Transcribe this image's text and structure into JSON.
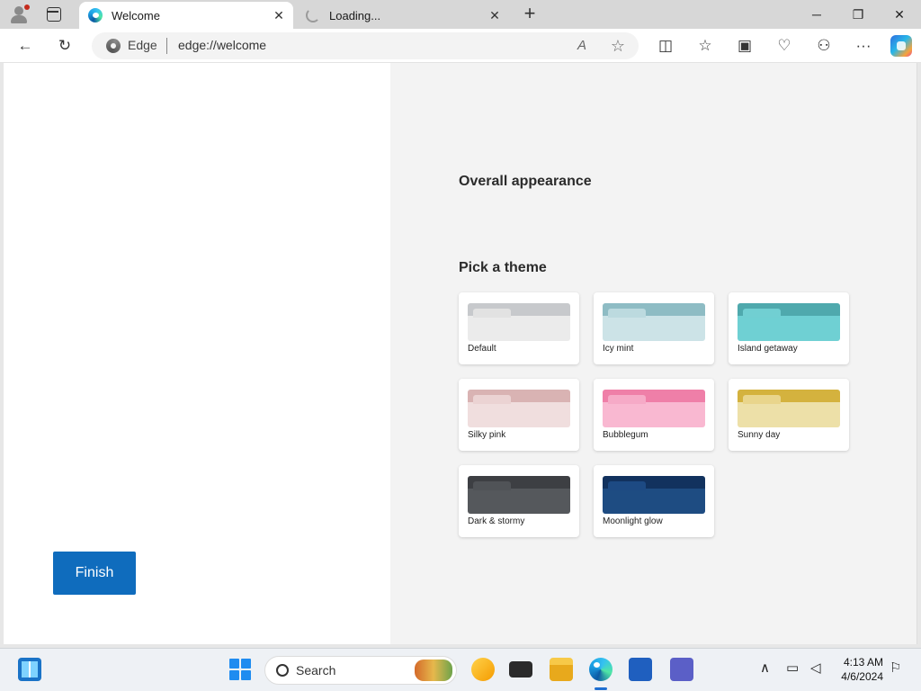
{
  "browser": {
    "tabs": [
      {
        "title": "Welcome",
        "close": "✕"
      },
      {
        "title": "Loading...",
        "close": "✕"
      }
    ],
    "new_tab": "+",
    "window_controls": {
      "minimize": "─",
      "restore": "❐",
      "close": "✕"
    }
  },
  "toolbar": {
    "back": "←",
    "refresh": "↻",
    "site_label": "Edge",
    "url": "edge://welcome",
    "read_aloud": "A",
    "favorite": "☆",
    "split_screen": "◫",
    "favorites": "☆",
    "collections": "▣",
    "health": "♡",
    "extensions": "⚇",
    "more": "···"
  },
  "page": {
    "finish_label": "Finish",
    "overall_appearance": "Overall appearance",
    "pick_theme": "Pick a theme",
    "themes": [
      {
        "name": "Default",
        "bar": "#c7c9cc",
        "tab": "#e2e2e2",
        "content": "#ebebeb"
      },
      {
        "name": "Icy mint",
        "bar": "#8ebcc4",
        "tab": "#bcdadf",
        "content": "#cce3e7"
      },
      {
        "name": "Island getaway",
        "bar": "#4fa9ad",
        "tab": "#71cfd2",
        "content": "#6fd0d3"
      },
      {
        "name": "Silky pink",
        "bar": "#d9b3b3",
        "tab": "#ebd3d3",
        "content": "#f0dede"
      },
      {
        "name": "Bubblegum",
        "bar": "#ef7fa8",
        "tab": "#f6aac7",
        "content": "#f9b8d1"
      },
      {
        "name": "Sunny day",
        "bar": "#d4b23e",
        "tab": "#e9d58c",
        "content": "#ede0a8"
      },
      {
        "name": "Dark & stormy",
        "bar": "#3d3f43",
        "tab": "#505357",
        "content": "#55585c"
      },
      {
        "name": "Moonlight glow",
        "bar": "#12325e",
        "tab": "#1d4a83",
        "content": "#1e4c82"
      }
    ]
  },
  "taskbar": {
    "search_label": "Search",
    "clock_time": "4:13 AM",
    "clock_date": "4/6/2024",
    "chevron": "∧"
  }
}
